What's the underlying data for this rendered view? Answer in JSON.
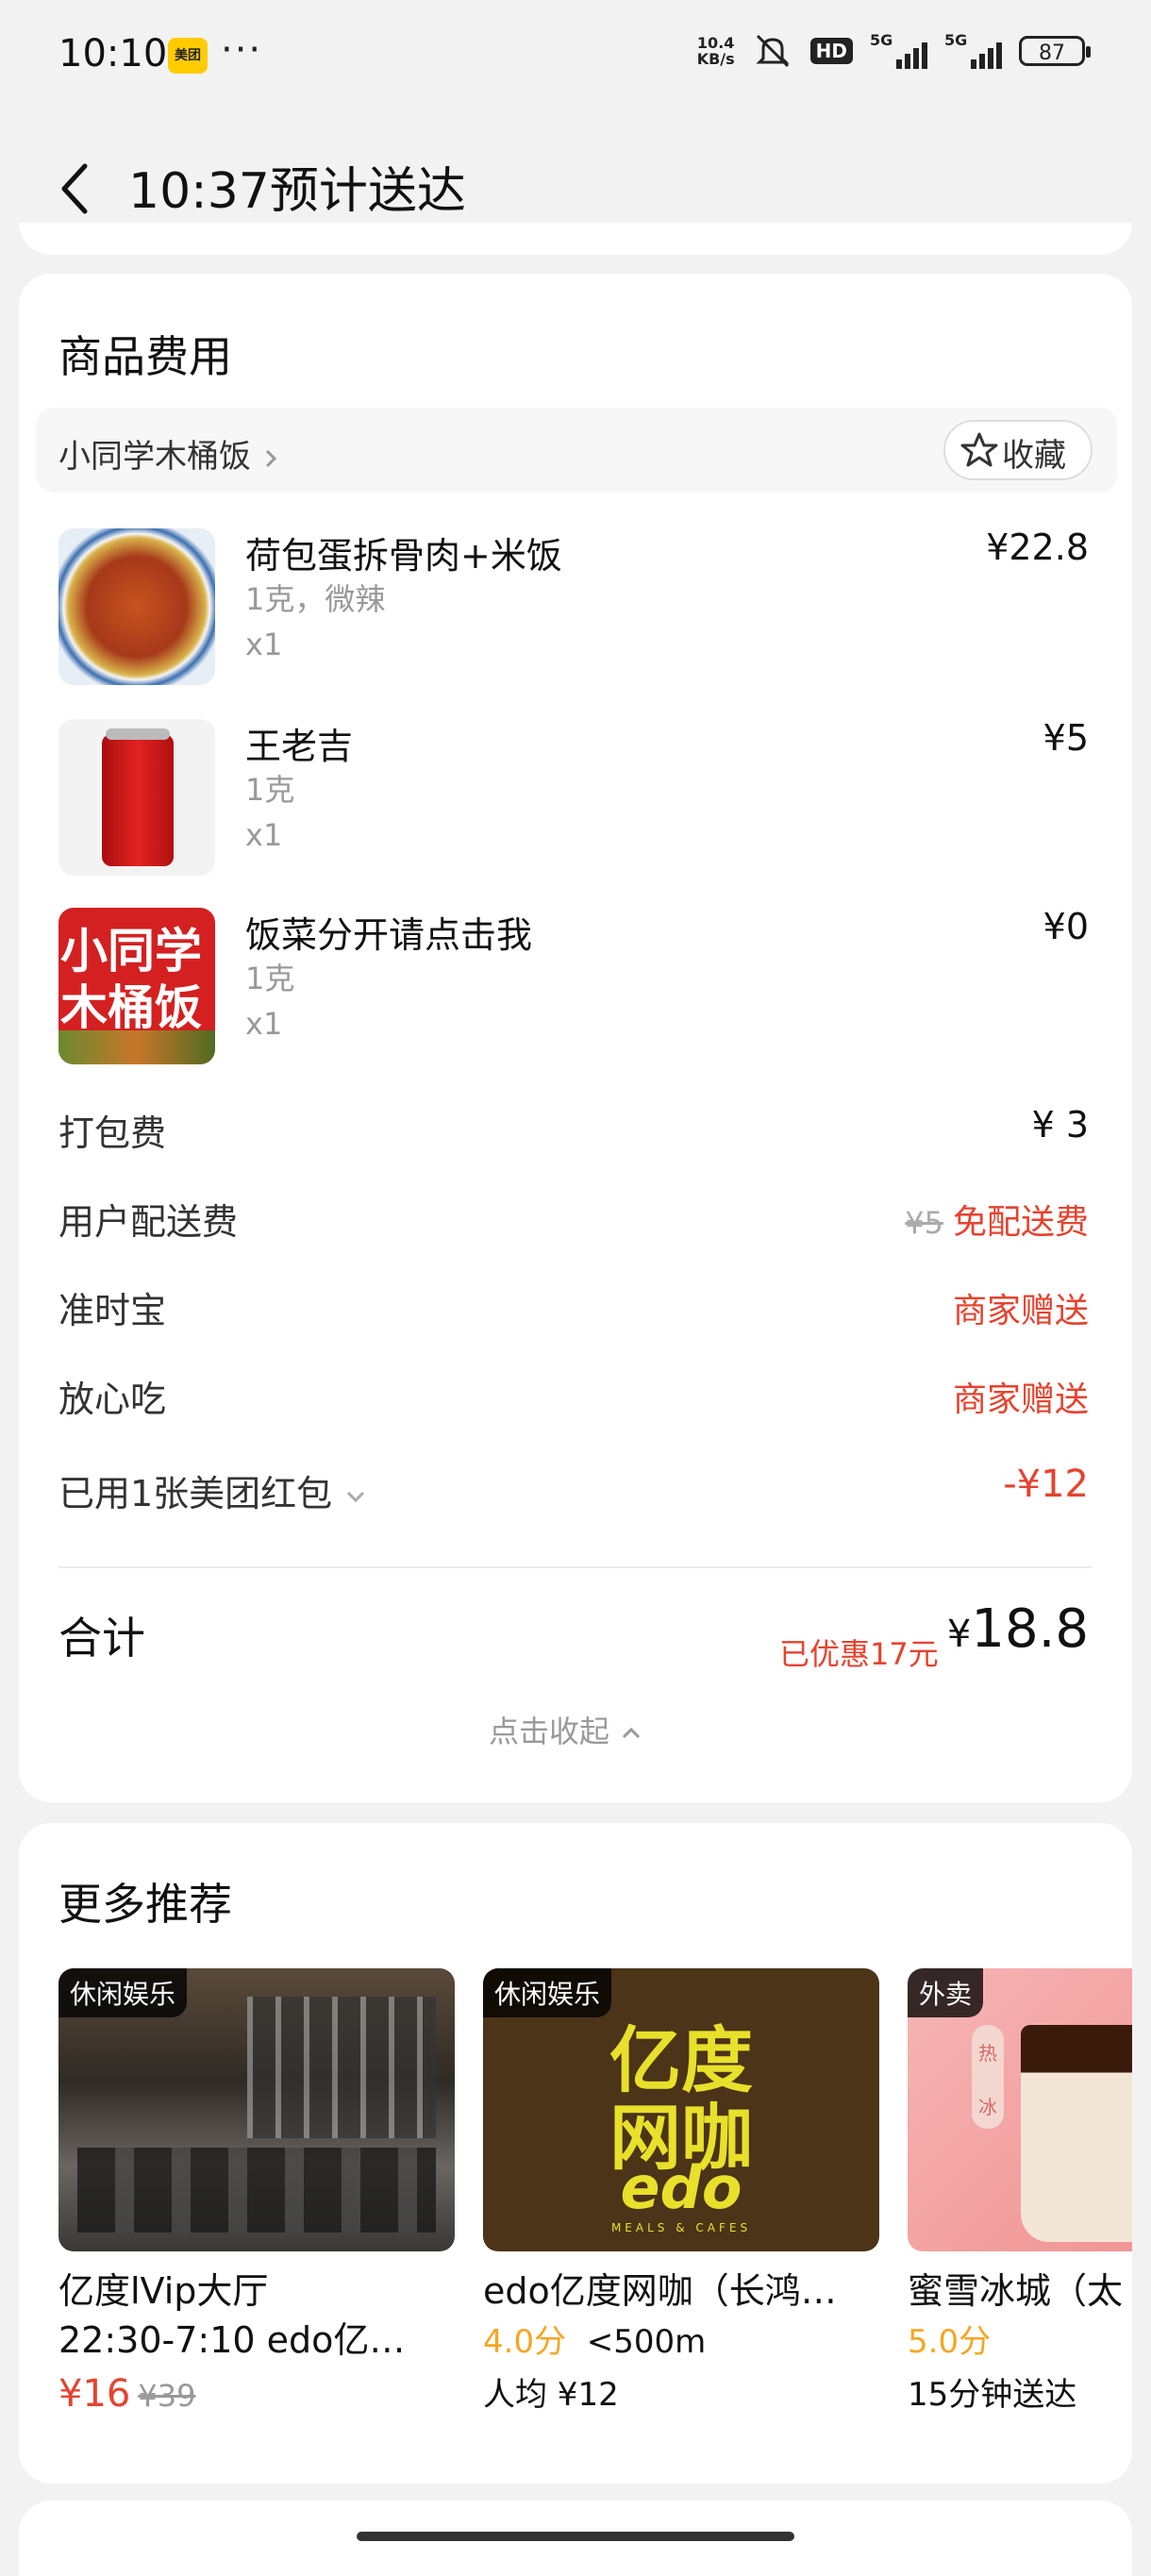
{
  "status_bar": {
    "time": "10:10",
    "app_badge": "美团",
    "more": "···",
    "net_speed_top": "10.4",
    "net_speed_bottom": "KB/s",
    "hd_label": "HD",
    "sig1_label": "5G",
    "sig2_label": "5G",
    "battery": "87"
  },
  "header": {
    "title": "10:37预计送达"
  },
  "goods_card": {
    "section_title": "商品费用",
    "shop_name": "小同学木桶饭",
    "favorite_label": "收藏",
    "items": [
      {
        "name": "荷包蛋拆骨肉+米饭",
        "spec": "1克，微辣",
        "qty": "x1",
        "price": "¥22.8"
      },
      {
        "name": "王老吉",
        "spec": "1克",
        "qty": "x1",
        "price": "¥5"
      },
      {
        "name": "饭菜分开请点击我",
        "spec": "1克",
        "qty": "x1",
        "price": "¥0"
      }
    ],
    "item3_image_text_line1": "小同学",
    "item3_image_text_line2": "木桶饭",
    "fees": {
      "packing_label": "打包费",
      "packing_value": "¥ 3",
      "delivery_label": "用户配送费",
      "delivery_original": "¥5",
      "delivery_value": "免配送费",
      "ontime_label": "准时宝",
      "ontime_value": "商家赠送",
      "assured_label": "放心吃",
      "assured_value": "商家赠送",
      "coupon_label": "已用1张美团红包",
      "coupon_value": "-¥12"
    },
    "total": {
      "label": "合计",
      "saved": "已优惠17元",
      "currency": "¥",
      "amount": "18.8"
    },
    "collapse_label": "点击收起"
  },
  "recommend": {
    "section_title": "更多推荐",
    "cards": [
      {
        "tag": "休闲娱乐",
        "title": "亿度lVip大厅",
        "title2": "22:30-7:10 edo亿…",
        "price": "¥16",
        "old_price": "¥39"
      },
      {
        "tag": "休闲娱乐",
        "title": "edo亿度网咖（长鸿…",
        "score": "4.0分",
        "distance": "<500m",
        "avg": "人均 ¥12",
        "logo_line1": "亿度",
        "logo_line2": "网咖",
        "logo_line3": "edo",
        "logo_sub": "MEALS & CAFES"
      },
      {
        "tag": "外卖",
        "title": "蜜雪冰城（太",
        "score": "5.0分",
        "eta": "15分钟送达",
        "sign1": "热",
        "sign2": "冰"
      }
    ]
  },
  "colors": {
    "accent_red": "#e5432f",
    "score_orange": "#f5a623",
    "background": "#f2f2f2"
  }
}
